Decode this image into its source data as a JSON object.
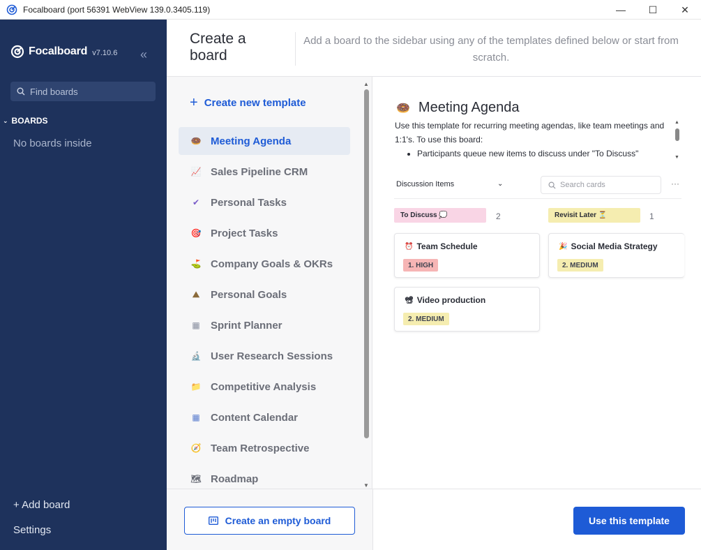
{
  "window": {
    "title": "Focalboard (port 56391 WebView 139.0.3405.119)",
    "minimize_glyph": "—",
    "maximize_glyph": "☐",
    "close_glyph": "✕"
  },
  "sidebar": {
    "brand": "Focalboard",
    "version": "v7.10.6",
    "collapse_glyph": "«",
    "search_placeholder": "Find boards",
    "boards_header": "BOARDS",
    "no_boards": "No boards inside",
    "add_board": "+ Add board",
    "settings": "Settings"
  },
  "dialog": {
    "title": "Create a board",
    "description": "Add a board to the sidebar using any of the templates defined below or start from scratch."
  },
  "templates": {
    "create_new": "Create new template",
    "items": [
      {
        "label": "Meeting Agenda",
        "icon": "donut-icon",
        "glyph": "🍩"
      },
      {
        "label": "Sales Pipeline CRM",
        "icon": "chart-icon",
        "glyph": "📈"
      },
      {
        "label": "Personal Tasks",
        "icon": "check-icon",
        "glyph": "✔"
      },
      {
        "label": "Project Tasks",
        "icon": "target-icon",
        "glyph": "🎯"
      },
      {
        "label": "Company Goals & OKRs",
        "icon": "golf-icon",
        "glyph": "⛳"
      },
      {
        "label": "Personal Goals",
        "icon": "mountain-icon",
        "glyph": "⛰"
      },
      {
        "label": "Sprint Planner",
        "icon": "calendar-icon",
        "glyph": "▦"
      },
      {
        "label": "User Research Sessions",
        "icon": "microscope-icon",
        "glyph": "🔬"
      },
      {
        "label": "Competitive Analysis",
        "icon": "folder-icon",
        "glyph": "📁"
      },
      {
        "label": "Content Calendar",
        "icon": "calendar-icon",
        "glyph": "▦"
      },
      {
        "label": "Team Retrospective",
        "icon": "compass-icon",
        "glyph": "🧭"
      },
      {
        "label": "Roadmap",
        "icon": "map-icon",
        "glyph": "🗺"
      }
    ]
  },
  "preview": {
    "title": "Meeting Agenda",
    "title_glyph": "🍩",
    "description": "Use this template for recurring meeting agendas, like team meetings and 1:1's. To use this board:",
    "bullet": "Participants queue new items to discuss under \"To Discuss\"",
    "view_name": "Discussion Items",
    "search_placeholder": "Search cards",
    "more_glyph": "···",
    "columns": [
      {
        "label": "To Discuss 💭",
        "count": "2",
        "color": "#f9d5e5"
      },
      {
        "label": "Revisit Later ⏳",
        "count": "1",
        "color": "#f5edb0"
      }
    ],
    "cards": [
      {
        "title": "Team Schedule",
        "glyph": "⏰",
        "tag": "1. HIGH",
        "tag_color": "#f6b5b5"
      },
      {
        "title": "Social Media Strategy",
        "glyph": "🎉",
        "tag": "2. MEDIUM",
        "tag_color": "#f5edb0"
      },
      {
        "title": "Video production",
        "glyph": "📽",
        "tag": "2. MEDIUM",
        "tag_color": "#f5edb0"
      }
    ]
  },
  "footer": {
    "empty_board": "Create an empty board",
    "use_template": "Use this template"
  }
}
